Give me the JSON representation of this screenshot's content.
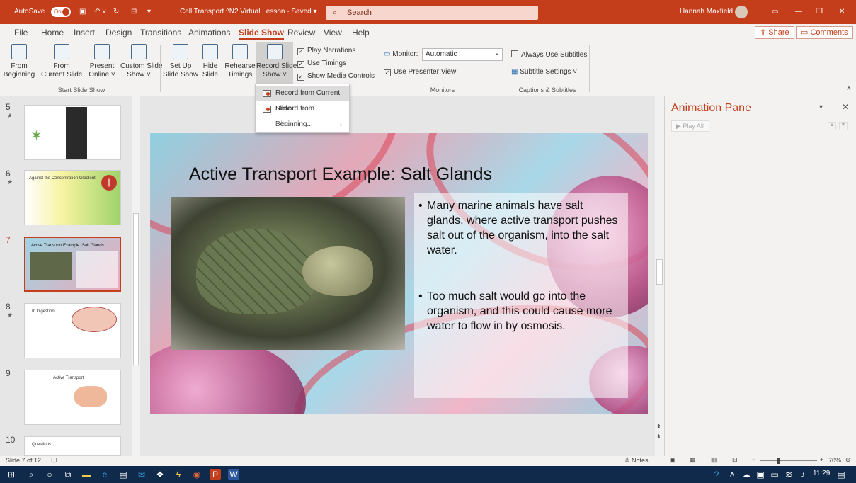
{
  "titlebar": {
    "autosave": "AutoSave",
    "autosave_state": "On",
    "doc_title": "Cell Transport ^N2 Virtual Lesson - Saved ▾",
    "search_placeholder": "Search",
    "user": "Hannah Maxfield"
  },
  "menu": {
    "items": [
      "File",
      "Home",
      "Insert",
      "Design",
      "Transitions",
      "Animations",
      "Slide Show",
      "Review",
      "View",
      "Help"
    ],
    "share": "Share",
    "comments": "Comments"
  },
  "ribbon": {
    "buttons": [
      "From\nBeginning",
      "From\nCurrent Slide",
      "Present\nOnline ˅",
      "Custom Slide\nShow ˅",
      "Set Up\nSlide Show",
      "Hide\nSlide",
      "Rehearse\nTimings",
      "Record Slide\nShow ˅"
    ],
    "checks": [
      "Play Narrations",
      "Use Timings",
      "Show Media Controls"
    ],
    "monitor_label": "Monitor:",
    "monitor_value": "Automatic",
    "presenter_view": "Use Presenter View",
    "subtitles": "Always Use Subtitles",
    "subtitle_settings": "Subtitle Settings ˅",
    "groups": [
      "Start Slide Show",
      "Monitors",
      "Captions & Subtitles"
    ]
  },
  "dropdown": {
    "items": [
      "Record from Current Slide...",
      "Record from Beginning...",
      "Clear"
    ]
  },
  "thumbs": {
    "numbers": [
      "5",
      "6",
      "7",
      "8",
      "9",
      "10"
    ],
    "t6": "Against the Concentration Gradient",
    "t7": "Active Transport Example: Salt Glands",
    "t8": "In Digestion",
    "t9": "Active Transport",
    "t10": "Questions"
  },
  "slide": {
    "title": "Active Transport Example: Salt Glands",
    "bullet1": "Many marine animals have salt glands, where active transport pushes salt out of the organism, into the salt water.",
    "bullet2": "Too much salt would go into the organism, and this could cause more water to flow in by osmosis."
  },
  "anim": {
    "title": "Animation Pane",
    "play_all": "Play All"
  },
  "status": {
    "slide": "Slide 7 of 12",
    "notes": "Notes",
    "zoom": "70%"
  },
  "taskbar": {
    "time": "11:29"
  }
}
